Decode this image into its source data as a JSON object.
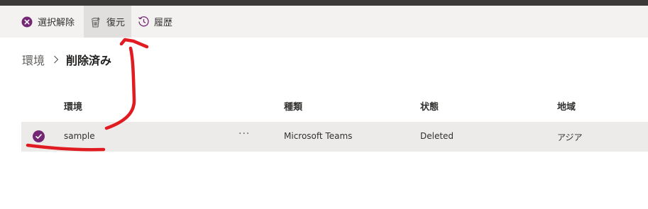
{
  "toolbar": {
    "clear_label": "選択解除",
    "restore_label": "復元",
    "history_label": "履歴"
  },
  "breadcrumb": {
    "parent": "環境",
    "current": "削除済み"
  },
  "table": {
    "headers": [
      "環境",
      "種類",
      "状態",
      "地域"
    ],
    "rows": [
      {
        "name": "sample",
        "more": "···",
        "type": "Microsoft Teams",
        "status": "Deleted",
        "region": "アジア",
        "selected": true
      }
    ]
  },
  "colors": {
    "accent": "#742774",
    "toolbar_bg": "#f3f2f1",
    "selected_row_bg": "#edebe9",
    "annotation": "#e11b22"
  }
}
